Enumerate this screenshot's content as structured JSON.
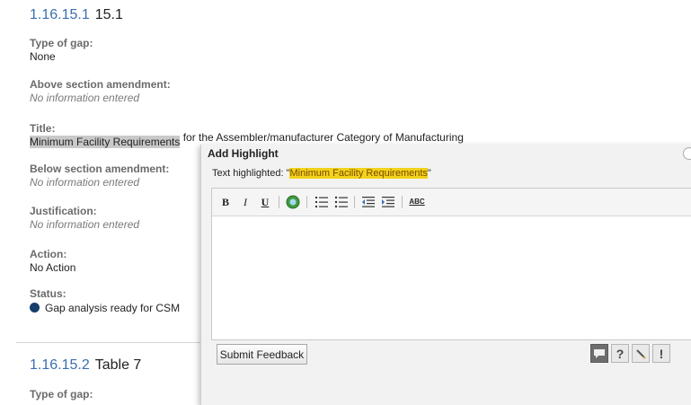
{
  "section1": {
    "number": "1.16.15.1",
    "title": "15.1",
    "type_of_gap_label": "Type of gap:",
    "type_of_gap_value": "None",
    "above_label": "Above section amendment:",
    "above_value": "No information entered",
    "title_label": "Title:",
    "title_selected": "Minimum Facility Requirements",
    "title_rest": " for the Assembler/manufacturer Category of Manufacturing",
    "below_label": "Below section amendment:",
    "below_value": "No information entered",
    "justification_label": "Justification:",
    "justification_value": "No information entered",
    "action_label": "Action:",
    "action_value": "No Action",
    "status_label": "Status:",
    "status_value": "Gap analysis ready for CSM"
  },
  "section2": {
    "number": "1.16.15.2",
    "title": "Table 7",
    "type_of_gap_label": "Type of gap:"
  },
  "dialog": {
    "title": "Add Highlight",
    "highlight_prefix": "Text highlighted: \"",
    "highlight_text": "Minimum Facility Requirements",
    "highlight_suffix": "\"",
    "toolbar": {
      "bold": "B",
      "italic": "I",
      "underline": "U",
      "spellcheck": "ABC"
    },
    "submit_label": "Submit Feedback",
    "icons": [
      "comment-icon",
      "help-icon",
      "pencil-icon",
      "alert-icon"
    ]
  },
  "colors": {
    "link_blue": "#3a6fb0",
    "status_dot": "#163d6b",
    "highlight_yellow": "#f2d21c"
  }
}
